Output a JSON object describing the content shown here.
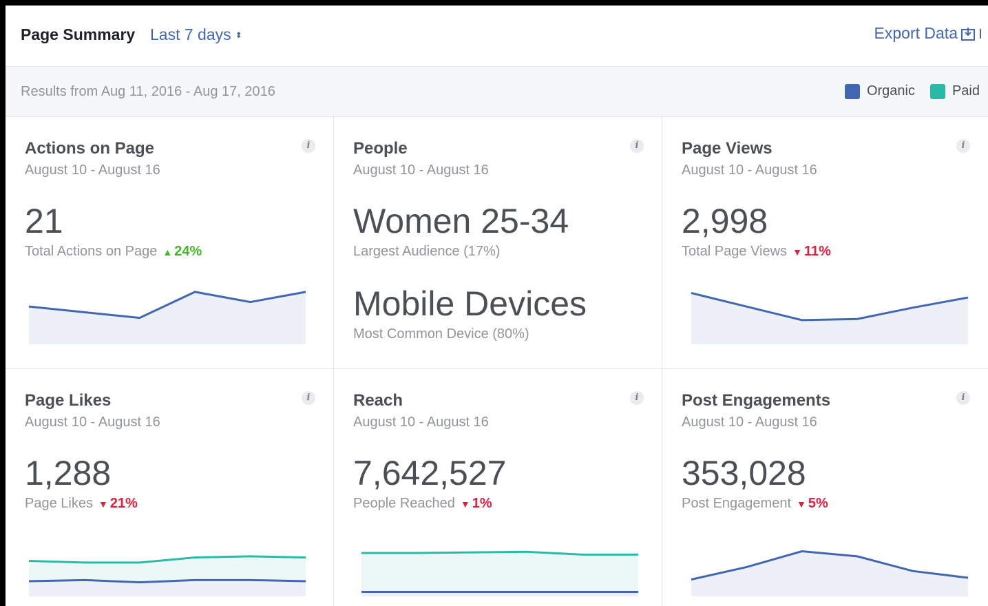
{
  "header": {
    "title": "Page Summary",
    "range": "Last 7 days",
    "export_label": "Export Data"
  },
  "subbar": {
    "results": "Results from Aug 11, 2016 - Aug 17, 2016",
    "legend": [
      {
        "label": "Organic",
        "color": "#4267b2"
      },
      {
        "label": "Paid",
        "color": "#2abba7"
      }
    ]
  },
  "cards": [
    {
      "title": "Actions on Page",
      "date": "August 10 - August 16",
      "value": "21",
      "caption": "Total Actions on Page",
      "delta": "24%",
      "delta_dir": "up",
      "chart_data": {
        "type": "area",
        "organic": [
          0.62,
          0.52,
          0.42,
          0.88,
          0.7,
          0.88
        ]
      }
    },
    {
      "title": "People",
      "date": "August 10 - August 16",
      "value": "Women 25-34",
      "caption": "Largest Audience (17%)",
      "value2": "Mobile Devices",
      "caption2": "Most Common Device (80%)"
    },
    {
      "title": "Page Views",
      "date": "August 10 - August 16",
      "value": "2,998",
      "caption": "Total Page Views",
      "delta": "11%",
      "delta_dir": "down",
      "chart_data": {
        "type": "area",
        "organic": [
          0.86,
          0.62,
          0.38,
          0.4,
          0.6,
          0.78
        ]
      }
    },
    {
      "title": "Page Likes",
      "date": "August 10 - August 16",
      "value": "1,288",
      "caption": "Page Likes",
      "delta": "21%",
      "delta_dir": "down",
      "chart_data": {
        "type": "area",
        "paid": [
          0.58,
          0.55,
          0.55,
          0.64,
          0.66,
          0.64
        ],
        "organic": [
          0.22,
          0.24,
          0.2,
          0.24,
          0.24,
          0.22
        ]
      }
    },
    {
      "title": "Reach",
      "date": "August 10 - August 16",
      "value": "7,642,527",
      "caption": "People Reached",
      "delta": "1%",
      "delta_dir": "down",
      "chart_data": {
        "type": "area",
        "paid": [
          0.72,
          0.72,
          0.73,
          0.74,
          0.69,
          0.69
        ],
        "organic": [
          0.03,
          0.03,
          0.03,
          0.03,
          0.03,
          0.03
        ]
      }
    },
    {
      "title": "Post Engagements",
      "date": "August 10 - August 16",
      "value": "353,028",
      "caption": "Post Engagement",
      "delta": "5%",
      "delta_dir": "down",
      "chart_data": {
        "type": "area",
        "organic": [
          0.25,
          0.47,
          0.75,
          0.66,
          0.4,
          0.28
        ]
      }
    }
  ]
}
